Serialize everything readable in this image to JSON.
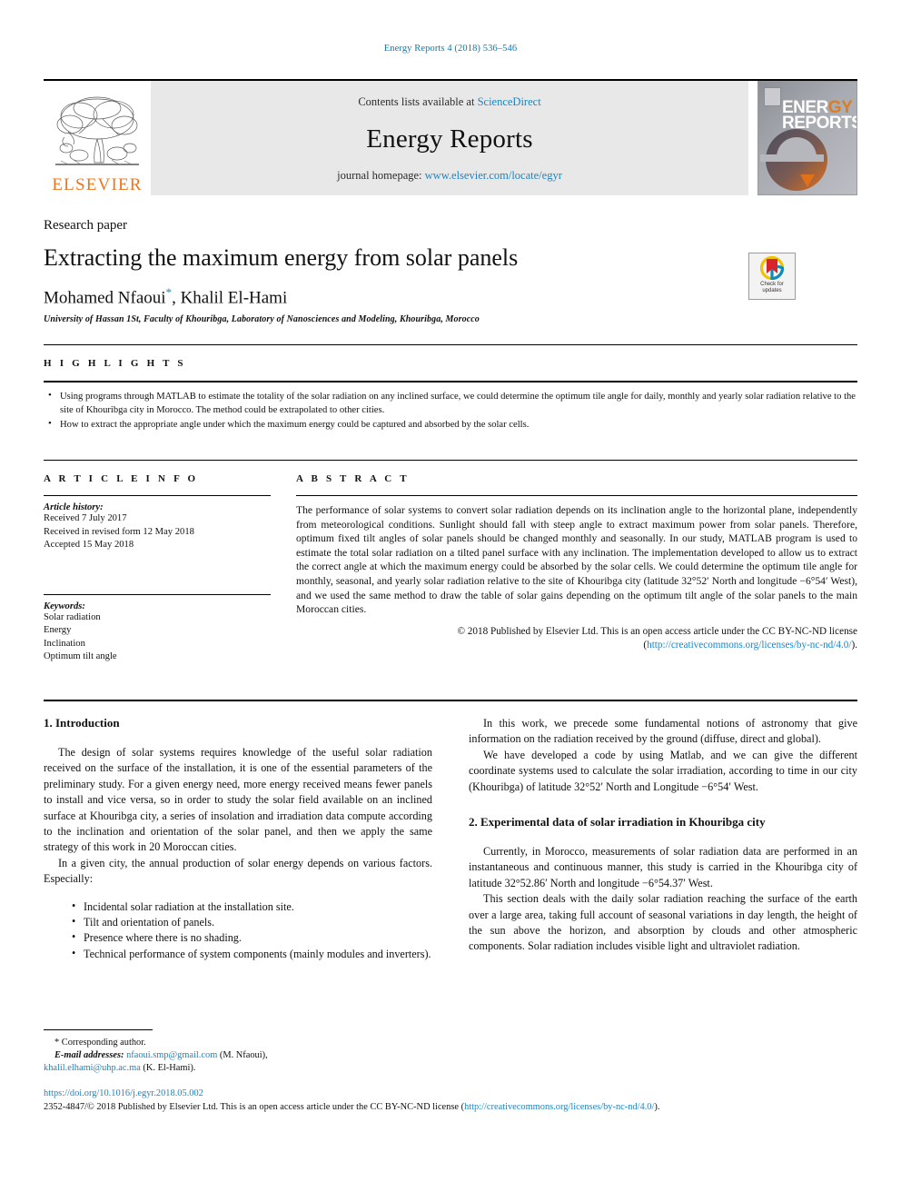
{
  "running_head": "Energy Reports 4 (2018) 536–546",
  "masthead": {
    "contents_prefix": "Contents lists available at ",
    "contents_link": "ScienceDirect",
    "journal_title": "Energy Reports",
    "homepage_prefix": "journal homepage: ",
    "homepage_link": "www.elsevier.com/locate/egyr",
    "publisher_word": "ELSEVIER",
    "cover_line1": "ENER",
    "cover_line1_accent": "GY",
    "cover_line2": "REPORTS"
  },
  "title_block": {
    "article_type": "Research paper",
    "title": "Extracting the maximum energy from solar panels",
    "authors": "Mohamed Nfaoui",
    "author_star": "*",
    "authors_rest": ", Khalil El-Hami",
    "affiliation": "University of Hassan 1St, Faculty of Khouribga, Laboratory of Nanosciences and Modeling, Khouribga, Morocco",
    "crossmark_line1": "Check for",
    "crossmark_line2": "updates"
  },
  "highlights": {
    "heading": "H I G H L I G H T S",
    "items": [
      "Using programs through MATLAB to estimate the totality of the solar radiation on any inclined surface, we could determine the optimum tile angle for daily, monthly and yearly solar radiation relative to the site of Khouribga city in Morocco. The method could be extrapolated to other cities.",
      "How to extract the appropriate angle under which the maximum energy could be captured and absorbed by the solar cells."
    ]
  },
  "article_info": {
    "heading": "A R T I C L E    I N F O",
    "history_label": "Article history:",
    "history_lines": [
      "Received 7 July 2017",
      "Received in revised form 12 May 2018",
      "Accepted 15 May 2018"
    ],
    "keywords_label": "Keywords:",
    "keywords": [
      "Solar radiation",
      "Energy",
      "Inclination",
      "Optimum tilt angle"
    ]
  },
  "abstract": {
    "heading": "A B S T R A C T",
    "text": "The performance of solar systems to convert solar radiation depends on its inclination angle to the horizontal plane, independently from meteorological conditions. Sunlight should fall with steep angle to extract maximum power from solar panels. Therefore, optimum fixed tilt angles of solar panels should be changed monthly and seasonally. In our study, MATLAB program is used to estimate the total solar radiation on a tilted panel surface with any inclination. The implementation developed to allow us to extract the correct angle at which the maximum energy could be absorbed by the solar cells. We could determine the optimum tile angle for monthly, seasonal, and yearly solar radiation relative to the site of Khouribga city (latitude 32°52′ North and longitude −6°54′ West), and we used the same method to draw the table of solar gains depending on the optimum tilt angle of the solar panels to the main Moroccan cities.",
    "copyright_text": "© 2018 Published by Elsevier Ltd. This is an open access article under the CC BY-NC-ND license",
    "license_open": "(",
    "license_link": "http://creativecommons.org/licenses/by-nc-nd/4.0/",
    "license_close": ")."
  },
  "body": {
    "left": {
      "section1_heading": "1. Introduction",
      "p1": "The design of solar systems requires knowledge of the useful solar radiation received on the surface of the installation, it is one of the essential parameters of the preliminary study. For a given energy need, more energy received means fewer panels to install and vice versa, so in order to study the solar field available on an inclined surface at Khouribga city, a series of insolation and irradiation data compute according to the inclination and orientation of the solar panel, and then we apply the same strategy of this work in 20 Moroccan cities.",
      "p2": "In a given city, the annual production of solar energy depends on various factors. Especially:",
      "bullets": [
        "Incidental solar radiation at the installation site.",
        "Tilt and orientation of panels.",
        "Presence where there is no shading.",
        "Technical performance of system components (mainly modules and inverters)."
      ]
    },
    "right": {
      "p1": "In this work, we precede some fundamental notions of astronomy that give information on the radiation received by the ground (diffuse, direct and global).",
      "p2": "We have developed a code by using Matlab, and we can give the different coordinate systems used to calculate the solar irradiation, according to time in our city (Khouribga) of latitude 32°52′ North and Longitude −6°54′ West.",
      "section2_heading": "2. Experimental data of solar irradiation in Khouribga city",
      "p3": "Currently, in Morocco, measurements of solar radiation data are performed in an instantaneous and continuous manner, this study is carried in the Khouribga city of latitude 32°52.86′ North and longitude −6°54.37′ West.",
      "p4": "This section deals with the daily solar radiation reaching the surface of the earth over a large area, taking full account of seasonal variations in day length, the height of the sun above the horizon, and absorption by clouds and other atmospheric components. Solar radiation includes visible light and ultraviolet radiation."
    }
  },
  "footnote": {
    "star": "*",
    "corresponding": " Corresponding author.",
    "email_label": "E-mail addresses:",
    "email1": "nfaoui.smp@gmail.com",
    "email1_who": " (M. Nfaoui),",
    "email2": "khalil.elhami@uhp.ac.ma",
    "email2_who": " (K. El-Hami)."
  },
  "doi_block": {
    "doi": "https://doi.org/10.1016/j.egyr.2018.05.002",
    "issn_copy": "2352-4847/© 2018 Published by Elsevier Ltd. This is an open access article under the CC BY-NC-ND license (",
    "license_link": "http://creativecommons.org/licenses/by-nc-nd/4.0/",
    "license_close": ").",
    "accent_link_color": "#1b85c4"
  }
}
